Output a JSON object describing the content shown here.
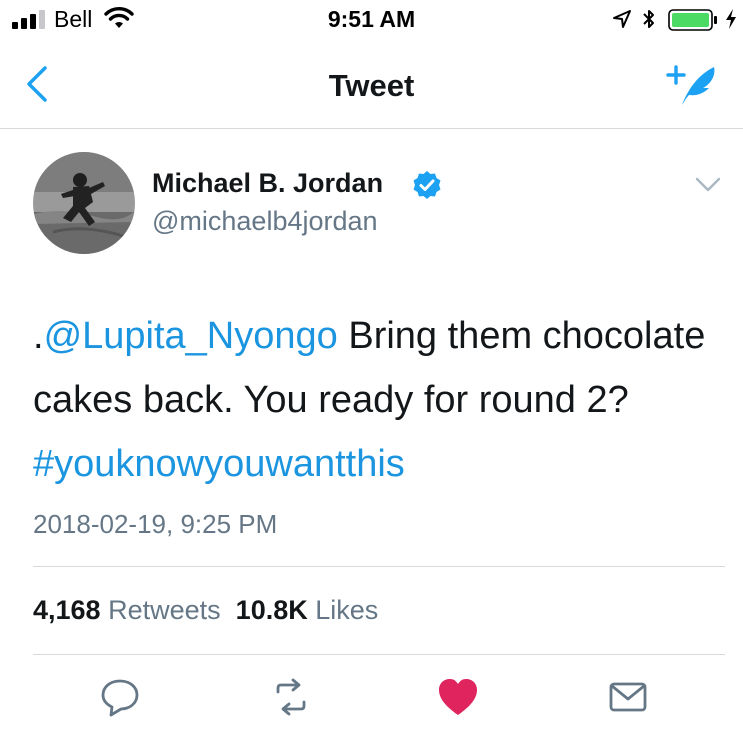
{
  "status_bar": {
    "carrier": "Bell",
    "time": "9:51 AM",
    "icons": [
      "signal-icon",
      "wifi-icon",
      "location-icon",
      "bluetooth-icon",
      "battery-icon",
      "charging-icon"
    ]
  },
  "nav": {
    "title": "Tweet",
    "back_icon": "back-chevron-icon",
    "compose_icon": "compose-tweet-icon"
  },
  "tweet": {
    "author": {
      "name": "Michael B. Jordan",
      "handle": "@michaelb4jordan",
      "verified": true
    },
    "text": {
      "prefix": ".",
      "mention": "@Lupita_Nyongo",
      "body": " Bring them chocolate cakes back. You ready for round 2? ",
      "hashtag": "#youknowyouwantthis"
    },
    "timestamp": "2018-02-19, 9:25 PM",
    "stats": {
      "retweets_count": "4,168",
      "retweets_label": "Retweets",
      "likes_count": "10.8K",
      "likes_label": "Likes"
    },
    "liked": true
  },
  "actions": [
    "reply-icon",
    "retweet-icon",
    "like-icon",
    "message-icon"
  ],
  "colors": {
    "accent": "#1da1f2",
    "link": "#1b95e0",
    "like": "#e0245e",
    "secondary_text": "#657786",
    "battery": "#4cd964"
  }
}
